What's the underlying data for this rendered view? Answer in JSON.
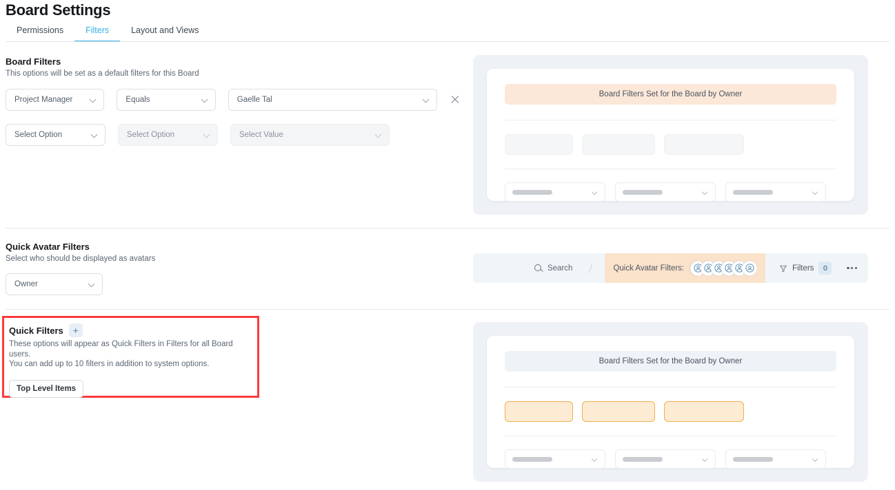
{
  "header": {
    "title": "Board Settings",
    "tabs": [
      {
        "label": "Permissions",
        "active": false
      },
      {
        "label": "Filters",
        "active": true
      },
      {
        "label": "Layout and Views",
        "active": false
      }
    ]
  },
  "board_filters": {
    "heading": "Board Filters",
    "subtitle": "This options will be set as a default filters for this Board",
    "rows": [
      {
        "field": "Project Manager",
        "operator": "Equals",
        "value": "Gaelle Tal",
        "remove_label": "×"
      },
      {
        "field": "Select Option",
        "operator": "Select Option",
        "value": "Select Value"
      }
    ],
    "preview": {
      "banner": "Board Filters Set for the Board by Owner"
    }
  },
  "quick_avatar_filters": {
    "heading": "Quick Avatar Filters",
    "subtitle": "Select who should be displayed as avatars",
    "selected": "Owner",
    "preview": {
      "search_label": "Search",
      "avatar_label": "Quick Avatar Filters:",
      "avatar_count": 6,
      "filters_label": "Filters",
      "filters_count": "0"
    }
  },
  "quick_filters": {
    "heading": "Quick Filters",
    "add_label": "+",
    "subtitle_line1": "These options will appear as Quick Filters in Filters for all Board users.",
    "subtitle_line2": "You can add up to 10 filters in addition to system options.",
    "chips": [
      "Top Level Items"
    ],
    "preview": {
      "banner": "Board Filters Set for the Board by Owner"
    }
  },
  "colors": {
    "accent": "#33b0e5",
    "highlight_border": "#fc3b3b",
    "peach_banner": "#fce8d9",
    "orange_chip": "#fdebd4",
    "orange_chip_border": "#eeaf4e",
    "bluegrey_banner": "#eff2f6",
    "avatar_zone": "#fbe2cb"
  }
}
